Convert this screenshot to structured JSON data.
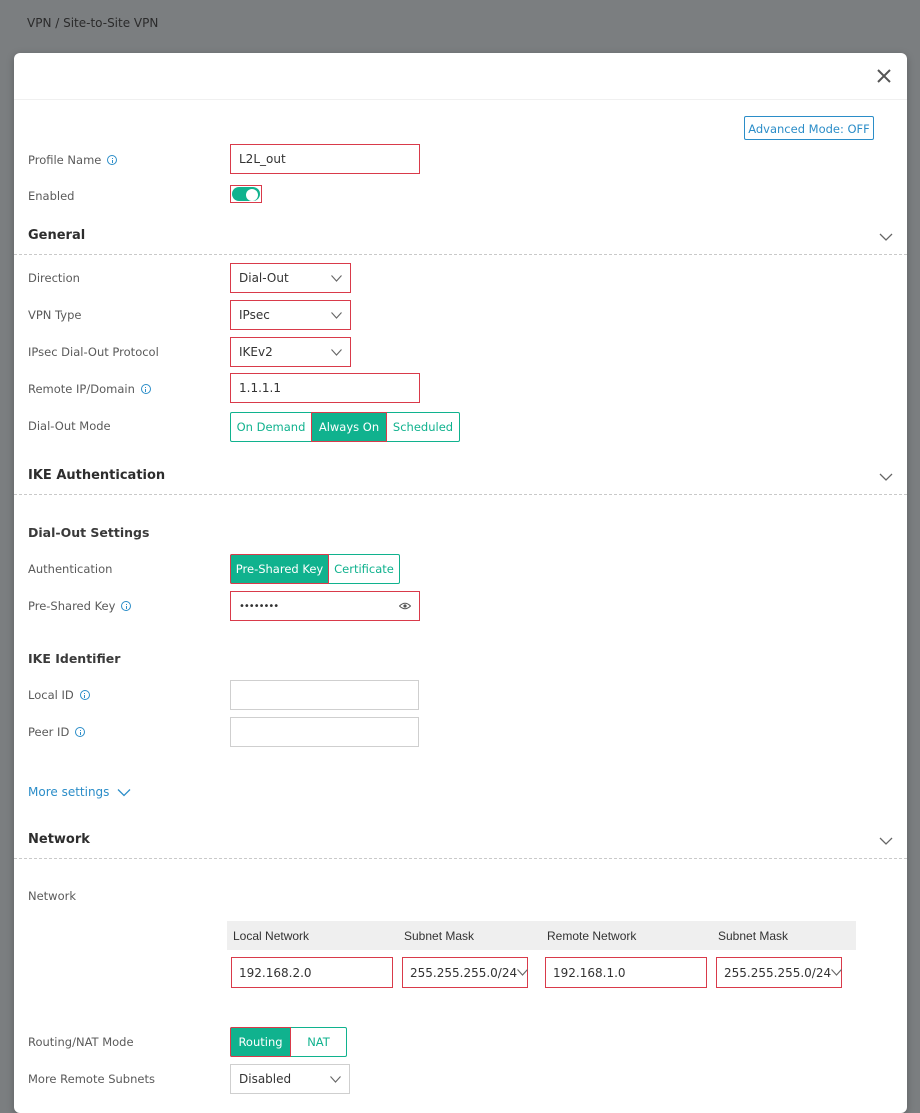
{
  "breadcrumb": "VPN / Site-to-Site VPN",
  "advanced_mode_label": "Advanced Mode: OFF",
  "profile": {
    "name_label": "Profile Name",
    "name_value": "L2L_out",
    "enabled_label": "Enabled",
    "enabled": true
  },
  "general": {
    "title": "General",
    "direction_label": "Direction",
    "direction_value": "Dial-Out",
    "vpn_type_label": "VPN Type",
    "vpn_type_value": "IPsec",
    "protocol_label": "IPsec Dial-Out Protocol",
    "protocol_value": "IKEv2",
    "remote_label": "Remote IP/Domain",
    "remote_value": "1.1.1.1",
    "dialout_mode_label": "Dial-Out Mode",
    "dialout_modes": [
      "On Demand",
      "Always On",
      "Scheduled"
    ],
    "dialout_mode_selected": "Always On"
  },
  "ike": {
    "title": "IKE Authentication",
    "dialout_settings": "Dial-Out Settings",
    "auth_label": "Authentication",
    "auth_options": [
      "Pre-Shared Key",
      "Certificate"
    ],
    "auth_selected": "Pre-Shared Key",
    "psk_label": "Pre-Shared Key",
    "psk_value": "••••••••",
    "identifier_title": "IKE Identifier",
    "local_id_label": "Local ID",
    "local_id_value": "",
    "peer_id_label": "Peer ID",
    "peer_id_value": "",
    "more_settings": "More settings"
  },
  "network": {
    "title": "Network",
    "network_label": "Network",
    "columns": [
      "Local Network",
      "Subnet Mask",
      "Remote Network",
      "Subnet Mask"
    ],
    "row": {
      "local_network": "192.168.2.0",
      "local_mask": "255.255.255.0/24",
      "remote_network": "192.168.1.0",
      "remote_mask": "255.255.255.0/24"
    },
    "routing_label": "Routing/NAT Mode",
    "routing_options": [
      "Routing",
      "NAT"
    ],
    "routing_selected": "Routing",
    "more_remote_label": "More Remote Subnets",
    "more_remote_value": "Disabled"
  },
  "colors": {
    "accent_green": "#10b28e",
    "accent_blue": "#2b8dc8",
    "error_red": "#d93a4a"
  },
  "icons": {
    "close": "close-icon",
    "info": "info-icon",
    "chevron": "chevron-down-icon",
    "eye": "eye-icon"
  }
}
